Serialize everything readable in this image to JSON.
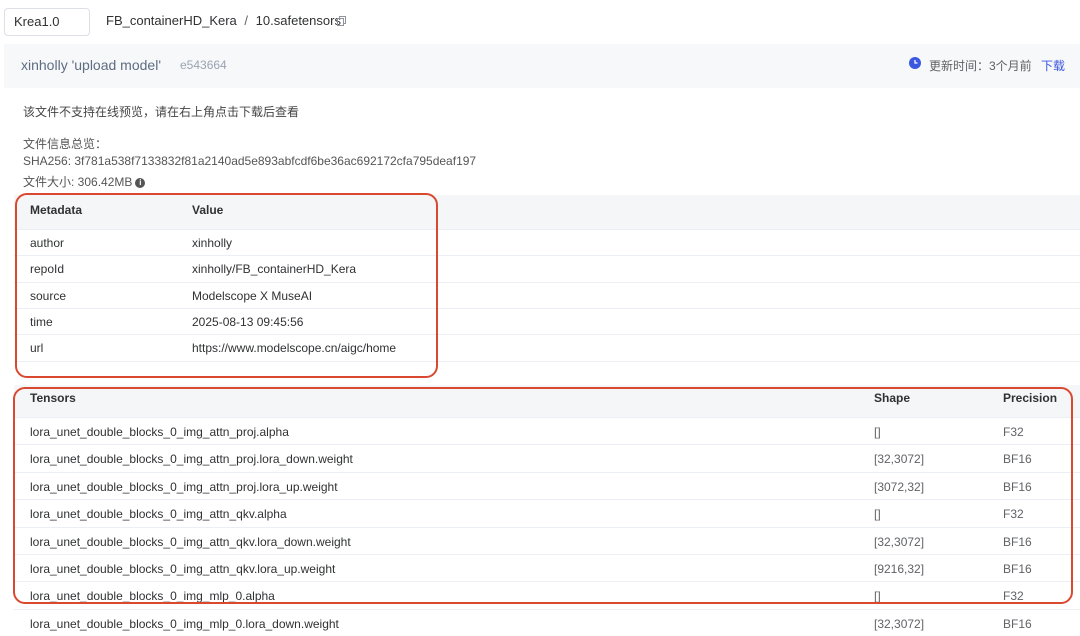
{
  "header": {
    "branch": "Krea1.0",
    "repo": "FB_containerHD_Kera",
    "separator": "/",
    "file": "10.safetensors"
  },
  "commit": {
    "message": "xinholly 'upload model'",
    "hash": "e543664",
    "update_label": "更新时间：3个月前",
    "download_label": "下载"
  },
  "notice": "该文件不支持在线预览，请在右上角点击下载后查看",
  "file_info": {
    "title": "文件信息总览：",
    "sha": "SHA256: 3f781a538f7133832f81a2140ad5e893abfcdf6be36ac692172cfa795deaf197",
    "size": "文件大小: 306.42MB"
  },
  "metadata": {
    "headers": [
      "Metadata",
      "Value"
    ],
    "rows": [
      [
        "author",
        "xinholly"
      ],
      [
        "repoId",
        "xinholly/FB_containerHD_Kera"
      ],
      [
        "source",
        "Modelscope X MuseAI"
      ],
      [
        "time",
        "2025-08-13 09:45:56"
      ],
      [
        "url",
        "https://www.modelscope.cn/aigc/home"
      ]
    ]
  },
  "tensors": {
    "headers": [
      "Tensors",
      "Shape",
      "Precision"
    ],
    "rows": [
      [
        "lora_unet_double_blocks_0_img_attn_proj.alpha",
        "[]",
        "F32"
      ],
      [
        "lora_unet_double_blocks_0_img_attn_proj.lora_down.weight",
        "[32,3072]",
        "BF16"
      ],
      [
        "lora_unet_double_blocks_0_img_attn_proj.lora_up.weight",
        "[3072,32]",
        "BF16"
      ],
      [
        "lora_unet_double_blocks_0_img_attn_qkv.alpha",
        "[]",
        "F32"
      ],
      [
        "lora_unet_double_blocks_0_img_attn_qkv.lora_down.weight",
        "[32,3072]",
        "BF16"
      ],
      [
        "lora_unet_double_blocks_0_img_attn_qkv.lora_up.weight",
        "[9216,32]",
        "BF16"
      ],
      [
        "lora_unet_double_blocks_0_img_mlp_0.alpha",
        "[]",
        "F32"
      ],
      [
        "lora_unet_double_blocks_0_img_mlp_0.lora_down.weight",
        "[32,3072]",
        "BF16"
      ]
    ]
  },
  "colors": {
    "highlight": "#d9492f",
    "link": "#3c57e0",
    "strip": "#f7f8fa"
  }
}
